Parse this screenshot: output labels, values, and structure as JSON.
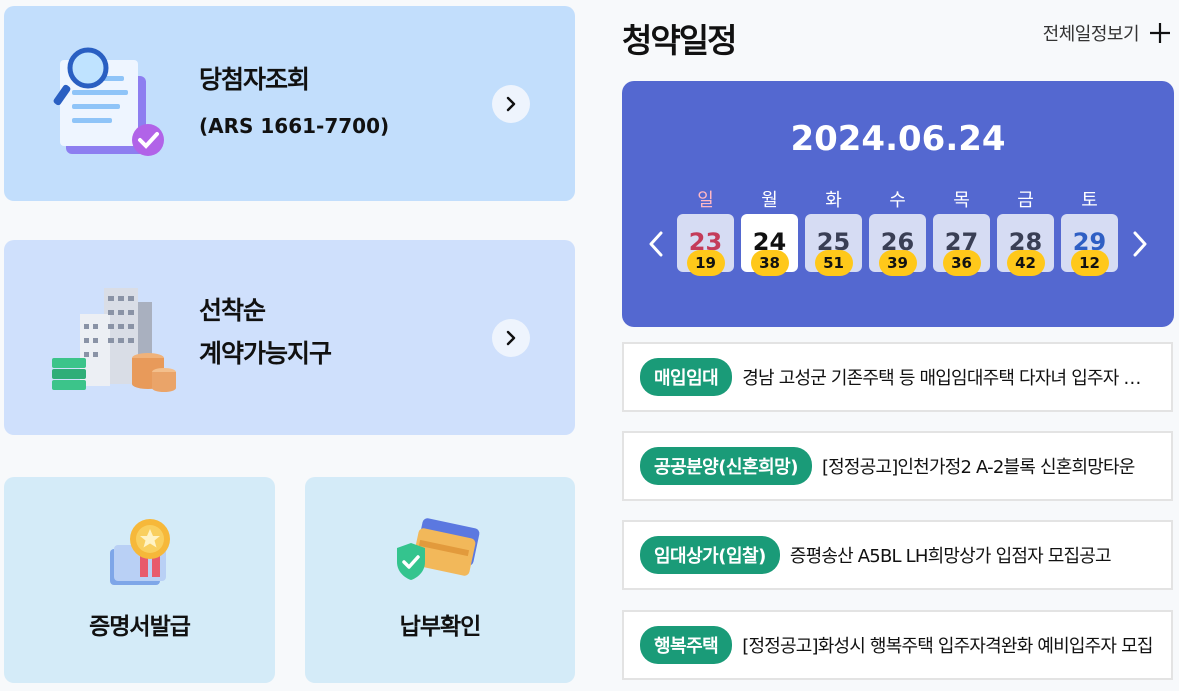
{
  "cards": {
    "winner": {
      "title": "당첨자조회",
      "subtitle": "(ARS 1661-7700)"
    },
    "contract": {
      "title_line1": "선착순",
      "title_line2": "계약가능지구"
    },
    "certificate": {
      "label": "증명서발급"
    },
    "payment": {
      "label": "납부확인"
    }
  },
  "schedule": {
    "title": "청약일정",
    "view_all": "전체일정보기",
    "date": "2024.06.24",
    "days": [
      {
        "dow": "일",
        "day": "23",
        "count": "19"
      },
      {
        "dow": "월",
        "day": "24",
        "count": "38"
      },
      {
        "dow": "화",
        "day": "25",
        "count": "51"
      },
      {
        "dow": "수",
        "day": "26",
        "count": "39"
      },
      {
        "dow": "목",
        "day": "27",
        "count": "36"
      },
      {
        "dow": "금",
        "day": "28",
        "count": "42"
      },
      {
        "dow": "토",
        "day": "29",
        "count": "12"
      }
    ],
    "selected_day": "24"
  },
  "notices": [
    {
      "badge": "매입임대",
      "text": "경남 고성군 기존주택 등 매입임대주택 다자녀 입주자 모집"
    },
    {
      "badge": "공공분양(신혼희망)",
      "text": "[정정공고]인천가정2 A-2블록 신혼희망타운"
    },
    {
      "badge": "임대상가(입찰)",
      "text": "증평송산 A5BL LH희망상가 입점자 모집공고"
    },
    {
      "badge": "행복주택",
      "text": "[정정공고]화성시 행복주택 입주자격완화 예비입주자 모집"
    }
  ],
  "colors": {
    "calendar_bg": "#5468d0",
    "count_badge": "#ffc81a",
    "notice_badge": "#1a9b78",
    "sunday": "#c43c5a",
    "saturday": "#2f5fc4"
  },
  "icons": {
    "winner": "document-search-icon",
    "contract": "apartment-coins-icon",
    "certificate": "certificate-medal-icon",
    "payment": "credit-card-shield-icon"
  }
}
